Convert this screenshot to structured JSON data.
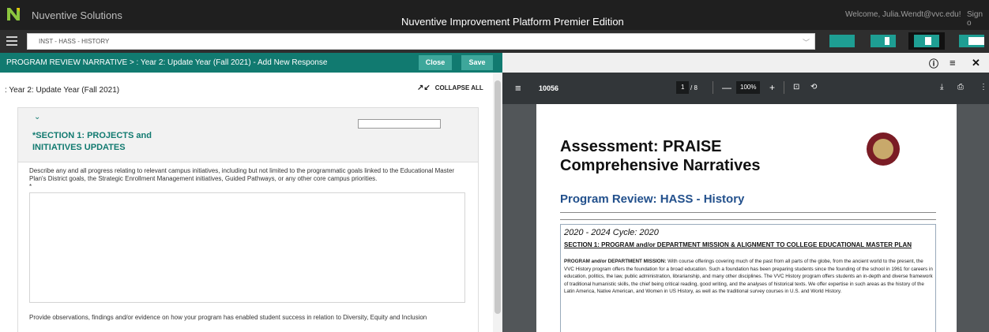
{
  "topbar": {
    "brand": "Nuventive Solutions",
    "app_title": "Nuventive Improvement Platform Premier Edition",
    "welcome": "Welcome, Julia.Wendt@vvc.edu!",
    "sign_out": "Sign o",
    "colors": {
      "bar": "#1f1f1f",
      "logo_green": "#8cc63f",
      "logo_yellow": "#f2c500"
    }
  },
  "breadcrumb": {
    "unit": "INST - HASS - HISTORY",
    "icons": [
      "hamburger-icon",
      "chevron-down-icon"
    ]
  },
  "left_header": {
    "title": "PROGRAM REVIEW NARRATIVE  >  : Year 2: Update Year (Fall 2021) - Add New Response",
    "close_label": "Close",
    "save_label": "Save",
    "color": "#117a70"
  },
  "right_header": {
    "icons": [
      "info-icon",
      "list-icon",
      "close-icon"
    ]
  },
  "form": {
    "year_title": ": Year 2: Update Year (Fall 2021)",
    "collapse_all": "COLLAPSE ALL",
    "section_title": "*SECTION 1: PROJECTS and INITIATIVES UPDATES",
    "prompt": "Describe any and all progress relating to relevant campus initiatives, including but not limited to the programmatic goals linked to the Educational Master Plan's District goals, the Strategic Enrollment Management initiatives, Guided Pathways, or any other core campus priorities.",
    "required_mark": "*",
    "prompt2": "Provide observations, findings and/or evidence on how your program has enabled student success in relation to Diversity, Equity and Inclusion"
  },
  "pdf": {
    "file_name": "10056",
    "page_current": "1",
    "page_total": "/ 8",
    "zoom": "100%",
    "zoom_out": "—",
    "zoom_in": "+",
    "title": "Assessment: PRAISE Comprehensive Narratives",
    "subtitle": "Program Review: HASS - History",
    "cycle": "2020 - 2024 Cycle: 2020",
    "section_heading": "SECTION 1: PROGRAM and/or DEPARTMENT MISSION  & ALIGNMENT TO COLLEGE EDUCATIONAL MASTER PLAN",
    "mission_label": "PROGRAM and/or DEPARTMENT MISSION:",
    "mission_text": " With course offerings covering much of the past from all parts of the globe, from the ancient world to the present, the VVC History program offers the foundation for a broad education. Such a foundation has been preparing students since the founding of the school in 1961 for careers in education, politics, the law, public administration, librarianship, and many other disciplines. The VVC History program offers students an in-depth and diverse framework of traditional humanistic skills, the chief being critical reading, good writing, and the analyses of historical texts. We offer expertise in such areas as the history of the Latin America, Native American, and Women in US History, as well as the traditional survey courses in U.S. and World History.",
    "toolbar_icons": [
      "menu-icon",
      "fit-page-icon",
      "rotate-icon",
      "download-icon",
      "print-icon",
      "more-icon"
    ]
  }
}
